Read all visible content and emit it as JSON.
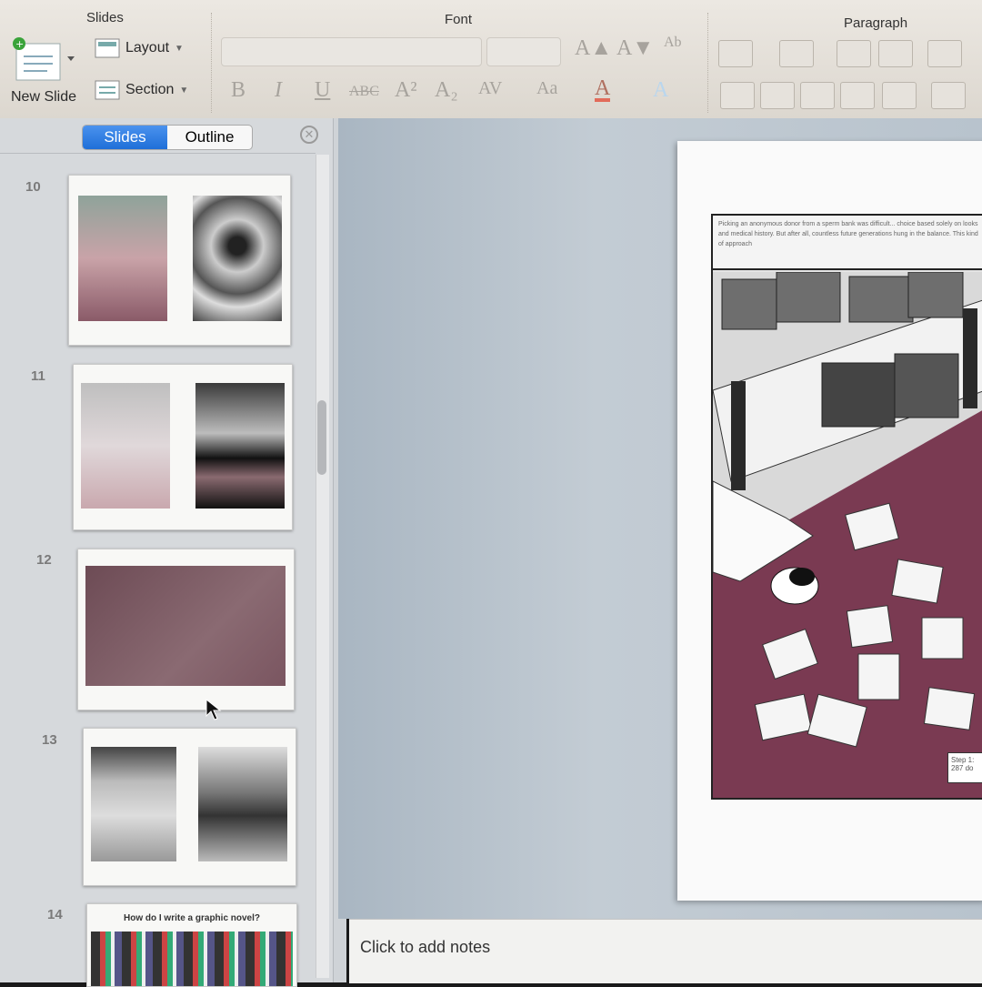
{
  "ribbon": {
    "slides_group": "Slides",
    "font_group": "Font",
    "paragraph_group": "Paragraph",
    "new_slide": "New Slide",
    "layout": "Layout",
    "section": "Section",
    "font_buttons": [
      "B",
      "I",
      "U",
      "ABC",
      "A²",
      "A₂",
      "AV",
      "Aa",
      "A"
    ],
    "grow_font": "A▲",
    "shrink_font": "A▼"
  },
  "panel": {
    "tab_slides": "Slides",
    "tab_outline": "Outline",
    "slide_numbers": [
      "10",
      "11",
      "12",
      "13",
      "14"
    ],
    "slide14_title": "How do I write a graphic novel?"
  },
  "slide_caption": "Picking an anonymous donor from a sperm bank was difficult... choice based solely on looks and medical history. But after all, countless future generations hung in the balance. This kind of approach",
  "slide_tag": "Step 1: 287 do",
  "notes_placeholder": "Click to add notes",
  "colors": {
    "accent": "#1f6fd8",
    "comic_maroon": "#7a3a52",
    "ribbon": "#e6e1da"
  }
}
